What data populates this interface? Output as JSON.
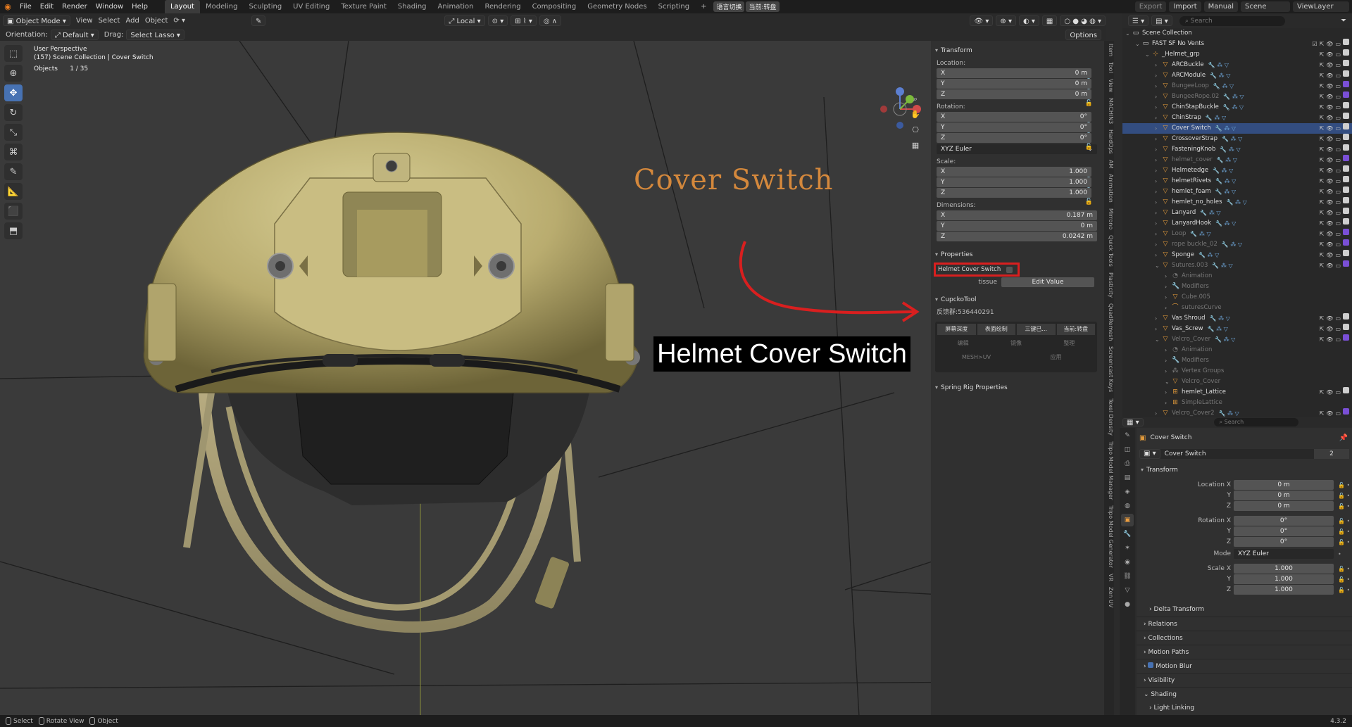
{
  "menu": {
    "logo": "blender-logo",
    "items": [
      "File",
      "Edit",
      "Render",
      "Window",
      "Help"
    ]
  },
  "workspaces": [
    {
      "label": "Layout",
      "active": true
    },
    {
      "label": "Modeling"
    },
    {
      "label": "Sculpting"
    },
    {
      "label": "UV Editing"
    },
    {
      "label": "Texture Paint"
    },
    {
      "label": "Shading"
    },
    {
      "label": "Animation"
    },
    {
      "label": "Rendering"
    },
    {
      "label": "Compositing"
    },
    {
      "label": "Geometry Nodes"
    },
    {
      "label": "Scripting"
    }
  ],
  "workspace_add": "+",
  "tag_chips": [
    "语言切换",
    "当前:转盘"
  ],
  "top_right": {
    "export": "Export",
    "import": "Import",
    "manual": "Manual",
    "scene": "Scene",
    "view_layer": "ViewLayer"
  },
  "viewport_header": {
    "mode": "Object Mode",
    "view": "View",
    "select": "Select",
    "add": "Add",
    "object": "Object",
    "transform_orientation": "Local",
    "options": "Options"
  },
  "header3": {
    "orientation_label": "Orientation:",
    "orientation_value": "Default",
    "drag_label": "Drag:",
    "drag_value": "Select Lasso"
  },
  "viewport_info": {
    "line1": "User Perspective",
    "line2": "(157) Scene Collection | Cover Switch",
    "objects_label": "Objects",
    "objects_value": "1 / 35"
  },
  "annotations": {
    "handwritten": "Cover Switch",
    "callout": "Helmet Cover Switch"
  },
  "npanel": {
    "transform_title": "Transform",
    "location_label": "Location:",
    "location": [
      {
        "axis": "X",
        "value": "0 m"
      },
      {
        "axis": "Y",
        "value": "0 m"
      },
      {
        "axis": "Z",
        "value": "0 m"
      }
    ],
    "rotation_label": "Rotation:",
    "rotation": [
      {
        "axis": "X",
        "value": "0°"
      },
      {
        "axis": "Y",
        "value": "0°"
      },
      {
        "axis": "Z",
        "value": "0°"
      }
    ],
    "rotation_mode": "XYZ Euler",
    "scale_label": "Scale:",
    "scale": [
      {
        "axis": "X",
        "value": "1.000"
      },
      {
        "axis": "Y",
        "value": "1.000"
      },
      {
        "axis": "Z",
        "value": "1.000"
      }
    ],
    "dimensions_label": "Dimensions:",
    "dimensions": [
      {
        "axis": "X",
        "value": "0.187 m"
      },
      {
        "axis": "Y",
        "value": "0 m"
      },
      {
        "axis": "Z",
        "value": "0.0242 m"
      }
    ],
    "properties_title": "Properties",
    "cover_switch_label": "Helmet Cover Switch",
    "tissue_label": "tissue",
    "edit_value": "Edit Value",
    "cupcko_title": "CupckoTool",
    "cupcko_id": "反馈群:536440291",
    "cupcko_buttons": [
      "屏幕深度",
      "表面绘制",
      "三键已...",
      "当前:转盘"
    ],
    "cupcko_row2": [
      "编辑",
      "镜像",
      "整理"
    ],
    "cupcko_row3": [
      "MESH>UV",
      "应用"
    ],
    "spring_title": "Spring Rig Properties"
  },
  "side_tabs": [
    "Item",
    "Tool",
    "View",
    "MACHIN3",
    "HardOps",
    "AM",
    "Animation",
    "Mirrono",
    "Quick Tools",
    "Plasticity",
    "QuadRemesh",
    "Screencast Keys",
    "Texel Density",
    "Tripo Model Manager",
    "Tripo Model Generator",
    "VR",
    "Zen UV"
  ],
  "outliner": {
    "search_placeholder": "Search",
    "rows": [
      {
        "label": "Scene Collection",
        "level": 0,
        "icon": "collection"
      },
      {
        "label": "FAST SF No Vents",
        "level": 1,
        "icon": "collection"
      },
      {
        "label": "_Helmet_grp",
        "level": 2,
        "icon": "empty"
      },
      {
        "label": "ARCBuckle",
        "level": 3,
        "icon": "mesh"
      },
      {
        "label": "ARCModule",
        "level": 3,
        "icon": "mesh"
      },
      {
        "label": "BungeeLoop",
        "level": 3,
        "icon": "mesh",
        "dim": true
      },
      {
        "label": "BungeeRope.02",
        "level": 3,
        "icon": "mesh",
        "dim": true
      },
      {
        "label": "ChinStapBuckle",
        "level": 3,
        "icon": "mesh"
      },
      {
        "label": "ChinStrap",
        "level": 3,
        "icon": "mesh"
      },
      {
        "label": "Cover Switch",
        "level": 3,
        "icon": "mesh",
        "selected": true
      },
      {
        "label": "CrossoverStrap",
        "level": 3,
        "icon": "mesh"
      },
      {
        "label": "FasteningKnob",
        "level": 3,
        "icon": "mesh"
      },
      {
        "label": "helmet_cover",
        "level": 3,
        "icon": "mesh",
        "dim": true
      },
      {
        "label": "Helmetedge",
        "level": 3,
        "icon": "mesh"
      },
      {
        "label": "helmetRivets",
        "level": 3,
        "icon": "mesh"
      },
      {
        "label": "hemlet_foam",
        "level": 3,
        "icon": "mesh"
      },
      {
        "label": "hemlet_no_holes",
        "level": 3,
        "icon": "mesh"
      },
      {
        "label": "Lanyard",
        "level": 3,
        "icon": "mesh"
      },
      {
        "label": "LanyardHook",
        "level": 3,
        "icon": "mesh"
      },
      {
        "label": "Loop",
        "level": 3,
        "icon": "mesh",
        "dim": true
      },
      {
        "label": "rope buckle_02",
        "level": 3,
        "icon": "mesh",
        "dim": true
      },
      {
        "label": "Sponge",
        "level": 3,
        "icon": "mesh"
      },
      {
        "label": "Sutures.003",
        "level": 3,
        "icon": "mesh",
        "dim": true
      },
      {
        "label": "Animation",
        "level": 4,
        "icon": "anim",
        "dim": true
      },
      {
        "label": "Modifiers",
        "level": 4,
        "icon": "wrench",
        "dim": true
      },
      {
        "label": "Cube.005",
        "level": 4,
        "icon": "mesh",
        "dim": true
      },
      {
        "label": "suturesCurve",
        "level": 4,
        "icon": "curve",
        "dim": true
      },
      {
        "label": "Vas Shroud",
        "level": 3,
        "icon": "mesh"
      },
      {
        "label": "Vas_Screw",
        "level": 3,
        "icon": "mesh"
      },
      {
        "label": "Velcro_Cover",
        "level": 3,
        "icon": "mesh",
        "dim": true
      },
      {
        "label": "Animation",
        "level": 4,
        "icon": "anim",
        "dim": true
      },
      {
        "label": "Modifiers",
        "level": 4,
        "icon": "wrench",
        "dim": true
      },
      {
        "label": "Vertex Groups",
        "level": 4,
        "icon": "vgroup",
        "dim": true
      },
      {
        "label": "Velcro_Cover",
        "level": 4,
        "icon": "mesh",
        "dim": true
      },
      {
        "label": "hemlet_Lattice",
        "level": 4,
        "icon": "lattice"
      },
      {
        "label": "SimpleLattice",
        "level": 4,
        "icon": "lattice",
        "dim": true
      },
      {
        "label": "Velcro_Cover2",
        "level": 3,
        "icon": "mesh",
        "dim": true
      }
    ]
  },
  "properties": {
    "search_placeholder": "Search",
    "object_name": "Cover Switch",
    "datablock_name": "Cover Switch",
    "users": "2",
    "transform_title": "Transform",
    "location_label": "Location X",
    "location": [
      "0 m",
      "0 m",
      "0 m"
    ],
    "rotation_label": "Rotation X",
    "rotation": [
      "0°",
      "0°",
      "0°"
    ],
    "mode_label": "Mode",
    "mode_value": "XYZ Euler",
    "scale_label": "Scale X",
    "scale": [
      "1.000",
      "1.000",
      "1.000"
    ],
    "y": "Y",
    "z": "Z",
    "sections": [
      "Delta Transform",
      "Relations",
      "Collections",
      "Motion Paths",
      "Motion Blur",
      "Visibility",
      "Shading",
      "Light Linking"
    ]
  },
  "statusbar": {
    "select": "Select",
    "rotate": "Rotate View",
    "object": "Object",
    "version": "4.3.2"
  },
  "colors": {
    "accent": "#4772b3",
    "red_box": "#d91f1f",
    "orange_text": "#d4883c",
    "selected_row": "#334d80"
  }
}
